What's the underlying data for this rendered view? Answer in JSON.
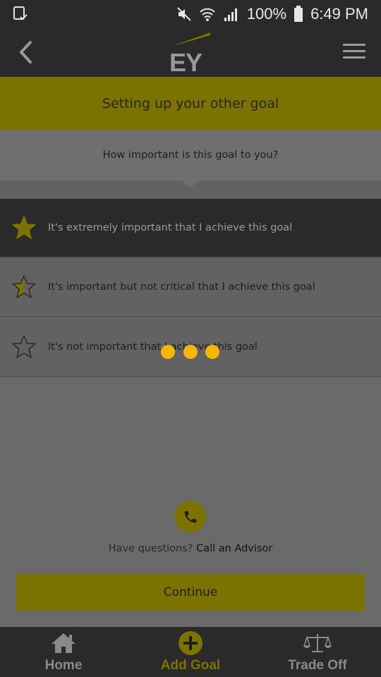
{
  "status_bar": {
    "battery": "100%",
    "time": "6:49 PM",
    "icons": [
      "screen-check-icon",
      "mute-icon",
      "wifi-icon",
      "signal-icon",
      "battery-icon"
    ]
  },
  "header": {
    "logo_text": "EY",
    "back_icon": "chevron-left-icon",
    "menu_icon": "hamburger-menu-icon"
  },
  "title": "Setting up your other goal",
  "question": "How important is this goal to you?",
  "options": [
    {
      "label": "It's extremely important that I achieve this goal",
      "icon": "star-filled-icon",
      "selected": true
    },
    {
      "label": "It's important but not critical that I achieve this goal",
      "icon": "star-half-icon",
      "selected": false
    },
    {
      "label": "It's not important that I achieve this goal",
      "icon": "star-outline-icon",
      "selected": false
    }
  ],
  "advisor": {
    "question": "Have questions?",
    "link": "Call an Advisor",
    "icon": "phone-icon"
  },
  "continue_label": "Continue",
  "bottom_nav": [
    {
      "label": "Home",
      "icon": "home-icon"
    },
    {
      "label": "Add Goal",
      "icon": "add-circle-icon",
      "active": true
    },
    {
      "label": "Trade Off",
      "icon": "scale-icon"
    }
  ],
  "colors": {
    "accent": "#7b7200",
    "loading_dot": "#f5b700",
    "dark_bar": "#2a2a2a"
  }
}
